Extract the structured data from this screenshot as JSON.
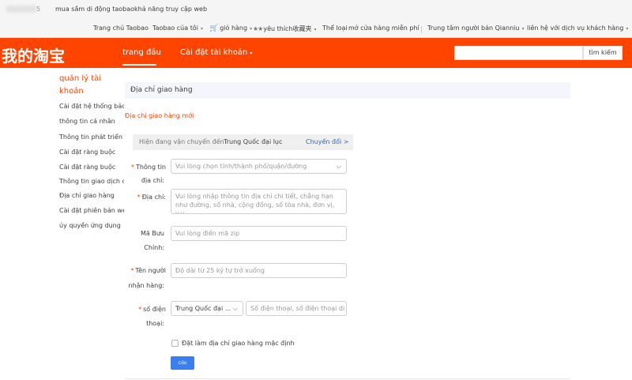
{
  "topbar": {
    "user_suffix": "5",
    "mobile_shopping": "mua sắm di động taobao",
    "accessibility": "khả năng truy cập web",
    "links": {
      "home": "Trang chủ Taobao",
      "my_taobao": "Taobao của tôi",
      "cart": "giỏ hàng",
      "favorites": "yêu thích收藏夹",
      "category": "Thể loại",
      "open_store": "mở cửa hàng miễn phí",
      "seller_center": "Trung tâm người bán Qianniu",
      "contact": "liên hệ với dịch vụ khách hàng"
    }
  },
  "header": {
    "logo": "我的淘宝",
    "nav_home": "trang đầu",
    "nav_account": "Cài đặt tài khoản",
    "search_value": "",
    "search_button": "tìm kiếm"
  },
  "sidebar": {
    "title": "quản lý tài khoản",
    "items": [
      "Cài đặt hệ thống bảo",
      "thông tin cá nhân",
      "Thông tin phát triển cá",
      "Cài đặt ràng buộc",
      "Cài đặt ràng buộc",
      "Thông tin giao dịch cá",
      "Địa chỉ giao hàng",
      "Cài đặt phiên bản web",
      "ủy quyền ứng dụng"
    ]
  },
  "main": {
    "section_title": "Địa chỉ giao hàng",
    "new_address": "Địa chỉ giao hàng mới",
    "shipping": {
      "label": "Hiện đang vận chuyển đến",
      "value": "Trung Quốc đại lục",
      "change": "Chuyển đổi >"
    },
    "form": {
      "region_label_1": "Thông tin",
      "region_label_2": "địa chỉ:",
      "region_placeholder": "Vui lòng chọn tỉnh/thành phố/quận/đường",
      "address_label": "Địa chỉ:",
      "address_placeholder": "Vui lòng nhập thông tin địa chỉ chi tiết, chẳng hạn như đường, số nhà, cộng đồng, số tòa nhà, đơn vị, v.v.",
      "zip_label_1": "Mã Bưu",
      "zip_label_2": "Chính:",
      "zip_placeholder": "Vui lòng điền mã zip",
      "name_label_1": "Tên người",
      "name_label_2": "nhận hàng:",
      "name_placeholder": "Độ dài từ 25 ký tự trở xuống",
      "phone_label_1": "số điện",
      "phone_label_2": "thoại:",
      "phone_country": "Trung Quốc đại ...",
      "phone_placeholder": "Số điện thoại, số điện thoại di động",
      "default_checkbox": "Đặt làm địa chỉ giao hàng mặc định",
      "save": "cứu"
    }
  },
  "colors": {
    "brand": "#ff4400",
    "link_blue": "#3366aa",
    "save_button": "#3b7ef0"
  }
}
